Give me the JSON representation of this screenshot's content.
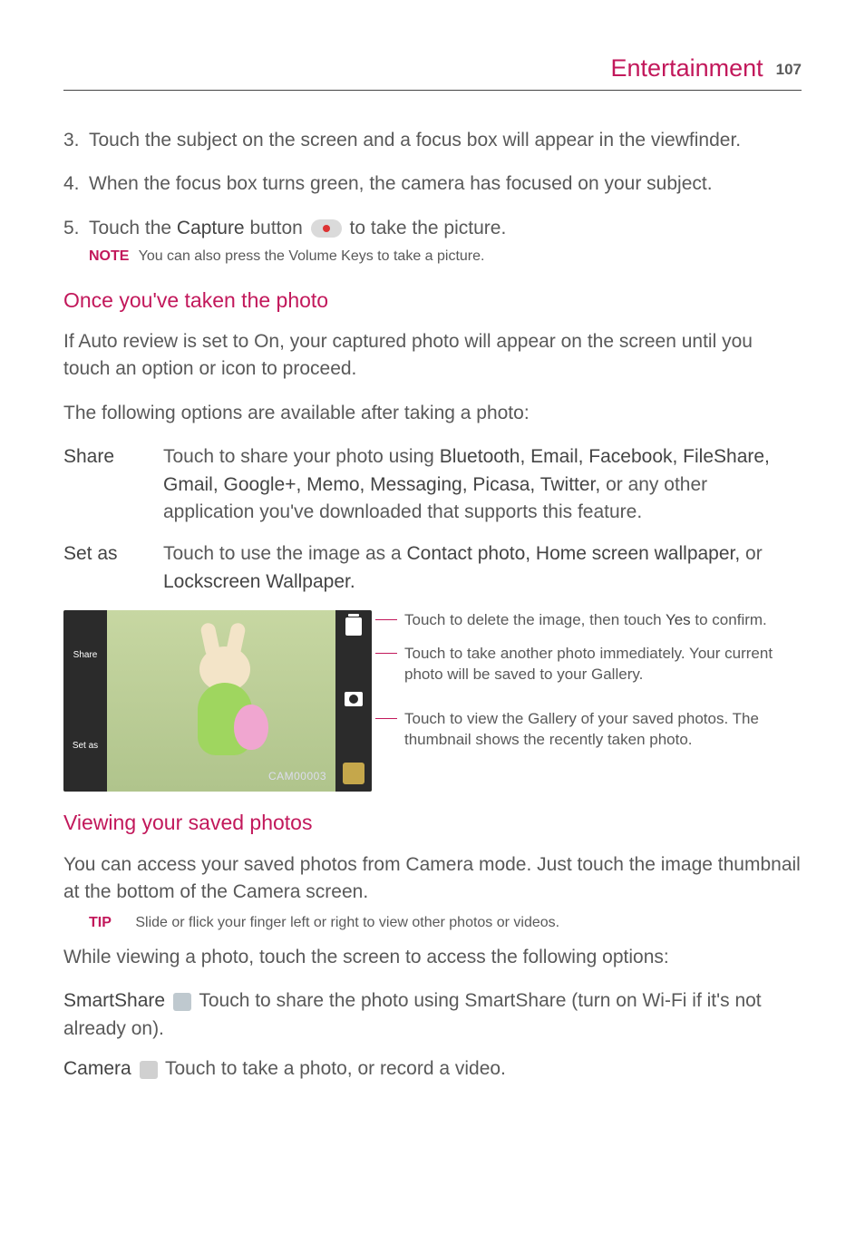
{
  "header": {
    "section": "Entertainment",
    "page": "107"
  },
  "steps": {
    "s3": {
      "num": "3.",
      "text": "Touch the subject on the screen and a focus box will appear in the viewfinder."
    },
    "s4": {
      "num": "4.",
      "text": "When the focus box turns green, the camera has focused on your subject."
    },
    "s5": {
      "num": "5.",
      "pre": "Touch the ",
      "bold": "Capture",
      "mid": " button ",
      "post": " to take the picture."
    }
  },
  "note": {
    "label": "NOTE",
    "text": "You can also press the Volume Keys to take a picture."
  },
  "sec1": {
    "title": "Once you've taken the photo",
    "p1": "If Auto review is set to On, your captured photo will appear on the screen until you touch an option or icon to proceed.",
    "p2": "The following options are available after taking a photo:"
  },
  "defs": {
    "share": {
      "term": "Share",
      "pre": "Touch to share your photo using ",
      "bold": "Bluetooth, Email, Facebook, FileShare, Gmail, Google+, Memo, Messaging, Picasa, Twitter,",
      "post": " or any other application you've downloaded that supports this feature."
    },
    "setas": {
      "term": "Set as",
      "pre": "Touch to use the image as a ",
      "bold1": "Contact photo, Home screen wallpaper,",
      "mid": " or ",
      "bold2": "Lockscreen Wallpaper."
    }
  },
  "preview": {
    "shareLabel": "Share",
    "setAsLabel": "Set as",
    "caption": "CAM00003"
  },
  "callouts": {
    "c1a": "Touch to delete the image, then touch ",
    "c1b": "Yes",
    "c1c": " to confirm.",
    "c2": "Touch to take another photo immediately. Your current photo will be saved to your Gallery.",
    "c3": "Touch to view the Gallery of your saved photos. The thumbnail shows the recently taken photo."
  },
  "sec2": {
    "title": "Viewing your saved photos",
    "p1": "You can access your saved photos from Camera mode. Just touch the image thumbnail at the bottom of the Camera screen."
  },
  "tip": {
    "label": "TIP",
    "text": "Slide or flick your finger left or right to view other photos or videos."
  },
  "p3": "While viewing a photo, touch the screen to access the following options:",
  "feat": {
    "smartshare": {
      "name": "SmartShare ",
      "text": " Touch to share the photo using SmartShare (turn on Wi-Fi if it's not already on)."
    },
    "camera": {
      "name": "Camera ",
      "text": " Touch to take a photo, or record a video."
    }
  }
}
